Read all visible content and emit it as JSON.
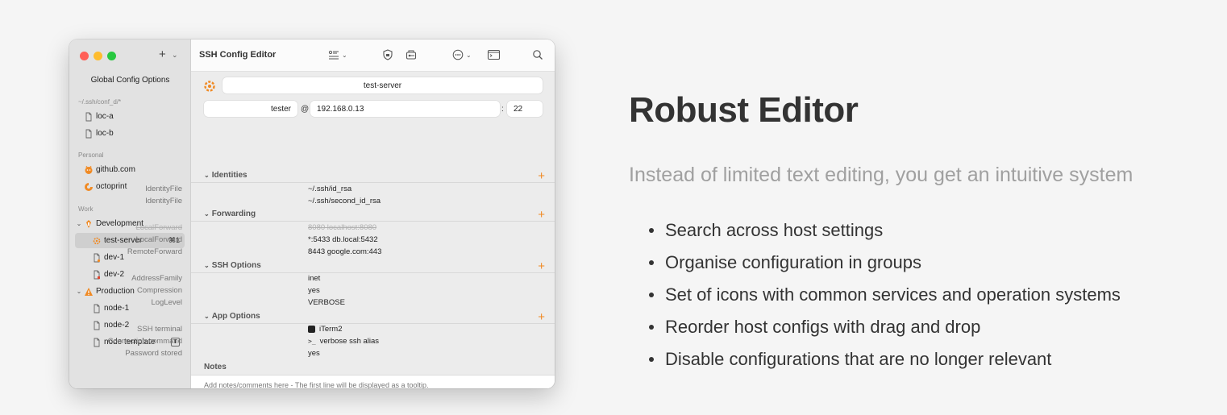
{
  "window": {
    "title": "SSH Config Editor",
    "traffic_colors": [
      "#ff5f57",
      "#febc2e",
      "#28c840"
    ],
    "accent": "#f08a24"
  },
  "sidebar": {
    "add_label": "+",
    "global_label": "Global Config Options",
    "sections": [
      {
        "label": "~/.ssh/conf_d/*"
      },
      {
        "label": "Personal"
      },
      {
        "label": "Work"
      }
    ],
    "items": [
      {
        "label": "loc-a"
      },
      {
        "label": "loc-b"
      },
      {
        "label": "github.com"
      },
      {
        "label": "octoprint"
      },
      {
        "label": "Development"
      },
      {
        "label": "test-server",
        "shortcut": "⌘1"
      },
      {
        "label": "dev-1"
      },
      {
        "label": "dev-2"
      },
      {
        "label": "Production"
      },
      {
        "label": "node-1"
      },
      {
        "label": "node-2"
      },
      {
        "label": "node template",
        "badge": "T"
      }
    ]
  },
  "host": {
    "name": "test-server",
    "user": "tester",
    "at": "@",
    "address": "192.168.0.13",
    "colon": ":",
    "port": "22"
  },
  "sections": {
    "identities": {
      "title": "Identities",
      "rows": [
        {
          "key": "IdentityFile",
          "value": "~/.ssh/id_rsa"
        },
        {
          "key": "IdentityFile",
          "value": "~/.ssh/second_id_rsa"
        }
      ]
    },
    "forwarding": {
      "title": "Forwarding",
      "rows": [
        {
          "key": "LocalForward",
          "value": "8080 localhost:8080",
          "disabled": true
        },
        {
          "key": "LocalForward",
          "value": "*:5433 db.local:5432"
        },
        {
          "key": "RemoteForward",
          "value": "8443 google.com:443"
        }
      ]
    },
    "ssh_options": {
      "title": "SSH Options",
      "rows": [
        {
          "key": "AddressFamily",
          "value": "inet"
        },
        {
          "key": "Compression",
          "value": "yes"
        },
        {
          "key": "LogLevel",
          "value": "VERBOSE"
        }
      ]
    },
    "app_options": {
      "title": "App Options",
      "rows": [
        {
          "key": "SSH terminal",
          "value": "iTerm2"
        },
        {
          "key": "Connection command",
          "value": "verbose ssh alias",
          "prefix": ">_"
        },
        {
          "key": "Password stored",
          "value": "yes"
        }
      ]
    }
  },
  "notes": {
    "label": "Notes",
    "placeholder": "Add notes/comments here - The first line will be displayed as a tooltip."
  },
  "marketing": {
    "headline": "Robust Editor",
    "subline": "Instead of limited text editing, you get an intuitive system",
    "bullets": [
      "Search across host settings",
      "Organise configuration in groups",
      "Set of icons with common services and operation systems",
      "Reorder host configs with drag and drop",
      "Disable configurations that are no longer relevant"
    ]
  }
}
